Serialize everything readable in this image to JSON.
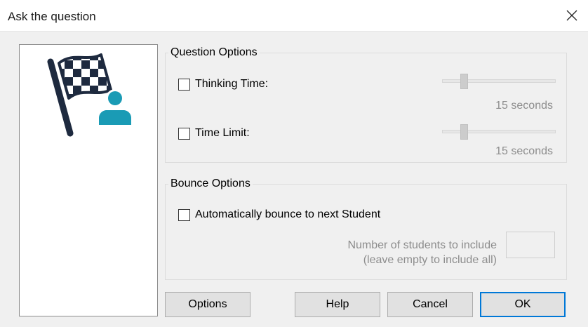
{
  "window": {
    "title": "Ask the question"
  },
  "question_options": {
    "group_label": "Question Options",
    "thinking_time": {
      "label": "Thinking Time:",
      "checked": false,
      "value_label": "15 seconds"
    },
    "time_limit": {
      "label": "Time Limit:",
      "checked": false,
      "value_label": "15 seconds"
    }
  },
  "bounce_options": {
    "group_label": "Bounce Options",
    "auto_bounce": {
      "label": "Automatically bounce to next Student",
      "checked": false
    },
    "students_label_line1": "Number of students to include",
    "students_label_line2": "(leave empty to include all)",
    "students_value": ""
  },
  "buttons": {
    "options": "Options",
    "help": "Help",
    "cancel": "Cancel",
    "ok": "OK"
  },
  "colors": {
    "flag": "#1e2a3f",
    "person": "#1a9bb5",
    "default_border": "#0078d7"
  },
  "icons": {
    "header": "flag-with-student-icon"
  }
}
